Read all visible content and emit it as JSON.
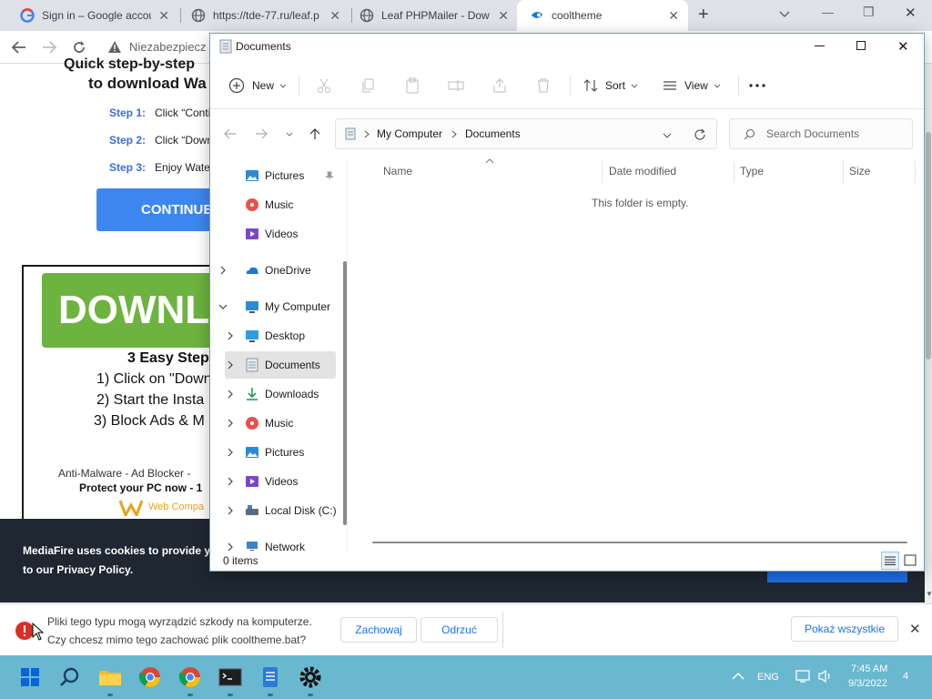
{
  "browser": {
    "tabs": [
      {
        "title": "Sign in – Google accou",
        "icon": "google-icon"
      },
      {
        "title": "https://tde-77.ru/leaf.p",
        "icon": "globe-icon"
      },
      {
        "title": "Leaf PHPMailer - Dow",
        "icon": "globe-icon"
      },
      {
        "title": "cooltheme",
        "icon": "mediafire-icon",
        "active": true
      }
    ],
    "address": "Niezabezpiecz",
    "new_tab": "+",
    "win_min": "—",
    "win_max": "❐",
    "win_close": "✕"
  },
  "page": {
    "heading_line1": "Quick step-by-step",
    "heading_line2": "to download Wa",
    "steps": [
      {
        "label": "Step 1:",
        "text": "Click “Contin"
      },
      {
        "label": "Step 2:",
        "text": "Click “Down"
      },
      {
        "label": "Step 3:",
        "text": "Enjoy Wate"
      }
    ],
    "continue_label": "CONTINUE",
    "download_big": "DOWNLO",
    "easy_steps_title": "3 Easy Step",
    "easy_steps": [
      "1) Click on \"Down",
      "2) Start the Insta",
      "3) Block Ads & M"
    ],
    "antimalware": "Anti-Malware - Ad Blocker -",
    "protect": "Protect your PC now - 1",
    "web_compat": "Web Compa",
    "cookie_line1": "MediaFire uses cookies to provide y",
    "cookie_line2": "to our Privacy Policy."
  },
  "download_bar": {
    "warning_line1": "Pliki tego typu mogą wyrządzić szkody na komputerze.",
    "warning_line2": "Czy chcesz mimo tego zachować plik cooltheme.bat?",
    "keep": "Zachowaj",
    "discard": "Odrzuć",
    "show_all": "Pokaż wszystkie"
  },
  "explorer": {
    "title": "Documents",
    "toolbar": {
      "new": "New",
      "sort": "Sort",
      "view": "View"
    },
    "breadcrumb": [
      "My Computer",
      "Documents"
    ],
    "search_placeholder": "Search Documents",
    "columns": [
      "Name",
      "Date modified",
      "Type",
      "Size"
    ],
    "empty_message": "This folder is empty.",
    "status": "0 items",
    "nav": [
      {
        "label": "Pictures",
        "icon": "pictures-icon",
        "pinned": true
      },
      {
        "label": "Music",
        "icon": "music-icon"
      },
      {
        "label": "Videos",
        "icon": "videos-icon"
      },
      {
        "label": "OneDrive",
        "icon": "onedrive-icon",
        "chevron": "right"
      },
      {
        "label": "My Computer",
        "icon": "computer-icon",
        "chevron": "down"
      },
      {
        "label": "Desktop",
        "icon": "desktop-icon",
        "chevron": "right"
      },
      {
        "label": "Documents",
        "icon": "documents-icon",
        "chevron": "right",
        "selected": true
      },
      {
        "label": "Downloads",
        "icon": "downloads-icon",
        "chevron": "right"
      },
      {
        "label": "Music",
        "icon": "music-icon",
        "chevron": "right"
      },
      {
        "label": "Pictures",
        "icon": "pictures-icon",
        "chevron": "right"
      },
      {
        "label": "Videos",
        "icon": "videos-icon",
        "chevron": "right"
      },
      {
        "label": "Local Disk (C:)",
        "icon": "disk-icon",
        "chevron": "right"
      },
      {
        "label": "Network",
        "icon": "network-icon",
        "chevron": "right"
      }
    ]
  },
  "taskbar": {
    "lang": "ENG",
    "time": "7:45 AM",
    "date": "9/3/2022",
    "notif_count": "4",
    "apps": [
      "start-icon",
      "search-icon",
      "file-explorer-icon",
      "chrome-icon",
      "chrome-icon",
      "terminal-icon",
      "notepad-icon",
      "settings-icon"
    ]
  },
  "colors": {
    "taskbar": "#69b8cf",
    "accent": "#1a73e8",
    "selection": "#e3e3e3",
    "cookie_bg": "#1f2733"
  }
}
